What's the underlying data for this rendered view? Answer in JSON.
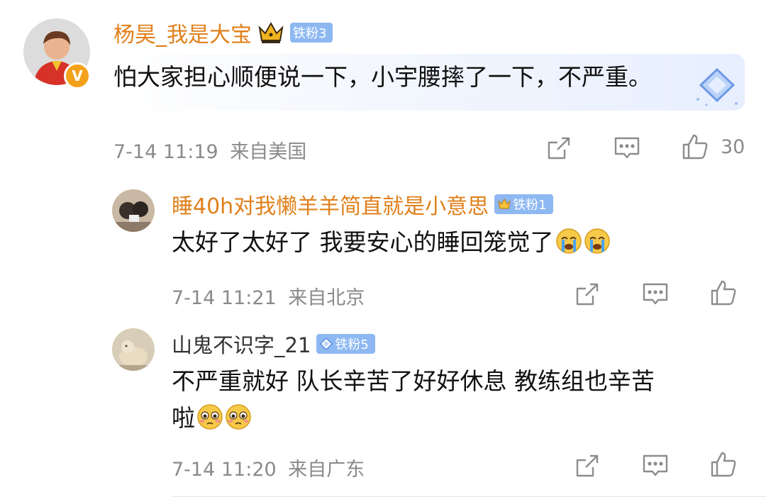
{
  "comments": [
    {
      "author": "杨昊_我是大宝",
      "verified_mark": "V",
      "fan_level": "铁粉3",
      "crown_icon": "gold-crown-icon",
      "text": "怕大家担心顺便说一下，小宇腰摔了一下，不严重。",
      "time": "7-14 11:19",
      "location": "来自美国",
      "likes": "30"
    },
    {
      "author": "睡40h对我懒羊羊简直就是小意思",
      "fan_level": "铁粉1",
      "crown_icon": "gold-crown-icon",
      "text": "太好了太好了 我要安心的睡回笼觉了",
      "emojis": [
        "crying-face-emoji",
        "crying-face-emoji"
      ],
      "time": "7-14 11:21",
      "location": "来自北京"
    },
    {
      "author": "山鬼不识字_21",
      "fan_level": "铁粉5",
      "text_line1": "不严重就好 队长辛苦了好好休息 教练组也辛苦",
      "text_line2": "啦",
      "emojis": [
        "pleading-face-emoji",
        "pleading-face-emoji"
      ],
      "time": "7-14 11:20",
      "location": "来自广东"
    }
  ],
  "colors": {
    "author_orange": "#e0801b",
    "meta_gray": "#8a8a8a",
    "fan_badge_blue": "#8db8f2",
    "icon_gray": "#8c8c8c"
  }
}
